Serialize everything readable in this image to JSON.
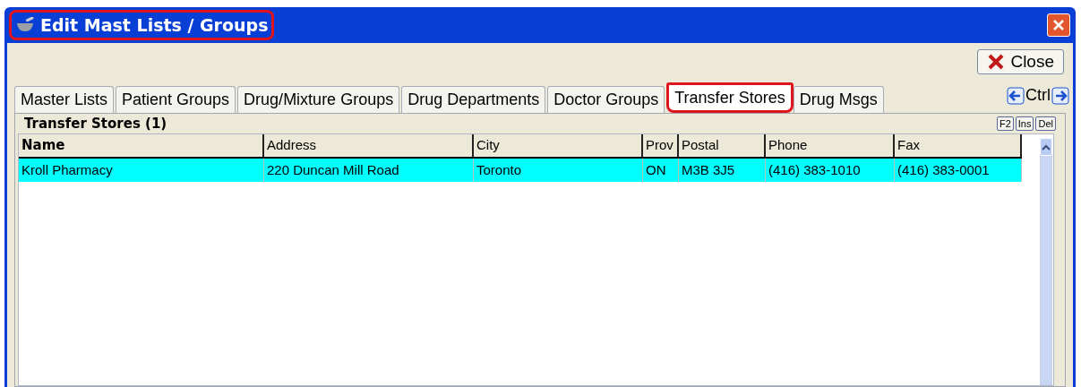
{
  "window": {
    "title": "Edit Mast Lists / Groups",
    "title_highlighted": true
  },
  "close_button": {
    "label": "Close"
  },
  "tabs": [
    {
      "label": "Master Lists",
      "selected": false,
      "highlighted": false
    },
    {
      "label": "Patient Groups",
      "selected": false,
      "highlighted": false
    },
    {
      "label": "Drug/Mixture Groups",
      "selected": false,
      "highlighted": false
    },
    {
      "label": "Drug Departments",
      "selected": false,
      "highlighted": false
    },
    {
      "label": "Doctor Groups",
      "selected": false,
      "highlighted": false
    },
    {
      "label": "Transfer Stores",
      "selected": true,
      "highlighted": true
    },
    {
      "label": "Drug Msgs",
      "selected": false,
      "highlighted": false
    }
  ],
  "tab_nav": {
    "label": "Ctrl"
  },
  "panel": {
    "title": "Transfer Stores (1)",
    "keys": [
      "F2",
      "Ins",
      "Del"
    ]
  },
  "table": {
    "columns": [
      "Name",
      "Address",
      "City",
      "Prov",
      "Postal",
      "Phone",
      "Fax"
    ],
    "rows": [
      {
        "selected": true,
        "cells": [
          "Kroll Pharmacy",
          "220 Duncan Mill Road",
          "Toronto",
          "ON",
          "M3B 3J5",
          "(416) 383-1010",
          "(416) 383-0001"
        ]
      }
    ]
  }
}
